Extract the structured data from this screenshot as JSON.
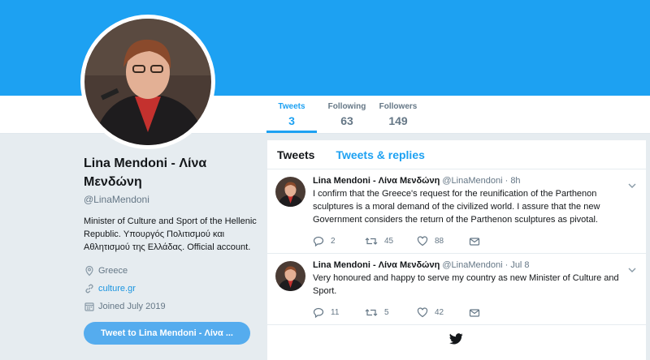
{
  "colors": {
    "brand": "#1da1f2",
    "page_bg": "#e6ecf0",
    "button": "#55acee"
  },
  "profile": {
    "name": "Lina Mendoni - Λίνα Μενδώνη",
    "handle": "@LinaMendoni",
    "bio": "Minister of Culture and Sport of the Hellenic Republic. Υπουργός Πολιτισμού και Αθλητισμού της Ελλάδας. Official account.",
    "location": "Greece",
    "website": "culture.gr",
    "joined": "Joined July 2019",
    "tweet_to_label": "Tweet to Lina Mendoni - Λίνα ..."
  },
  "stats": [
    {
      "label": "Tweets",
      "value": "3"
    },
    {
      "label": "Following",
      "value": "63"
    },
    {
      "label": "Followers",
      "value": "149"
    }
  ],
  "timeline": {
    "tabs": [
      "Tweets",
      "Tweets & replies"
    ],
    "tweets": [
      {
        "name": "Lina Mendoni - Λίνα Μενδώνη",
        "handle": "@LinaMendoni",
        "time": "· 8h",
        "text": "I confirm that the Greece's request for the reunification of the Parthenon sculptures is a moral demand of the civilized world. I assure that the new Government considers the return of the Parthenon sculptures as pivotal.",
        "replies": "2",
        "retweets": "45",
        "likes": "88"
      },
      {
        "name": "Lina Mendoni - Λίνα Μενδώνη",
        "handle": "@LinaMendoni",
        "time": "· Jul 8",
        "text": "Very honoured and happy to serve my country as new Minister of Culture and Sport.",
        "replies": "11",
        "retweets": "5",
        "likes": "42"
      }
    ]
  }
}
